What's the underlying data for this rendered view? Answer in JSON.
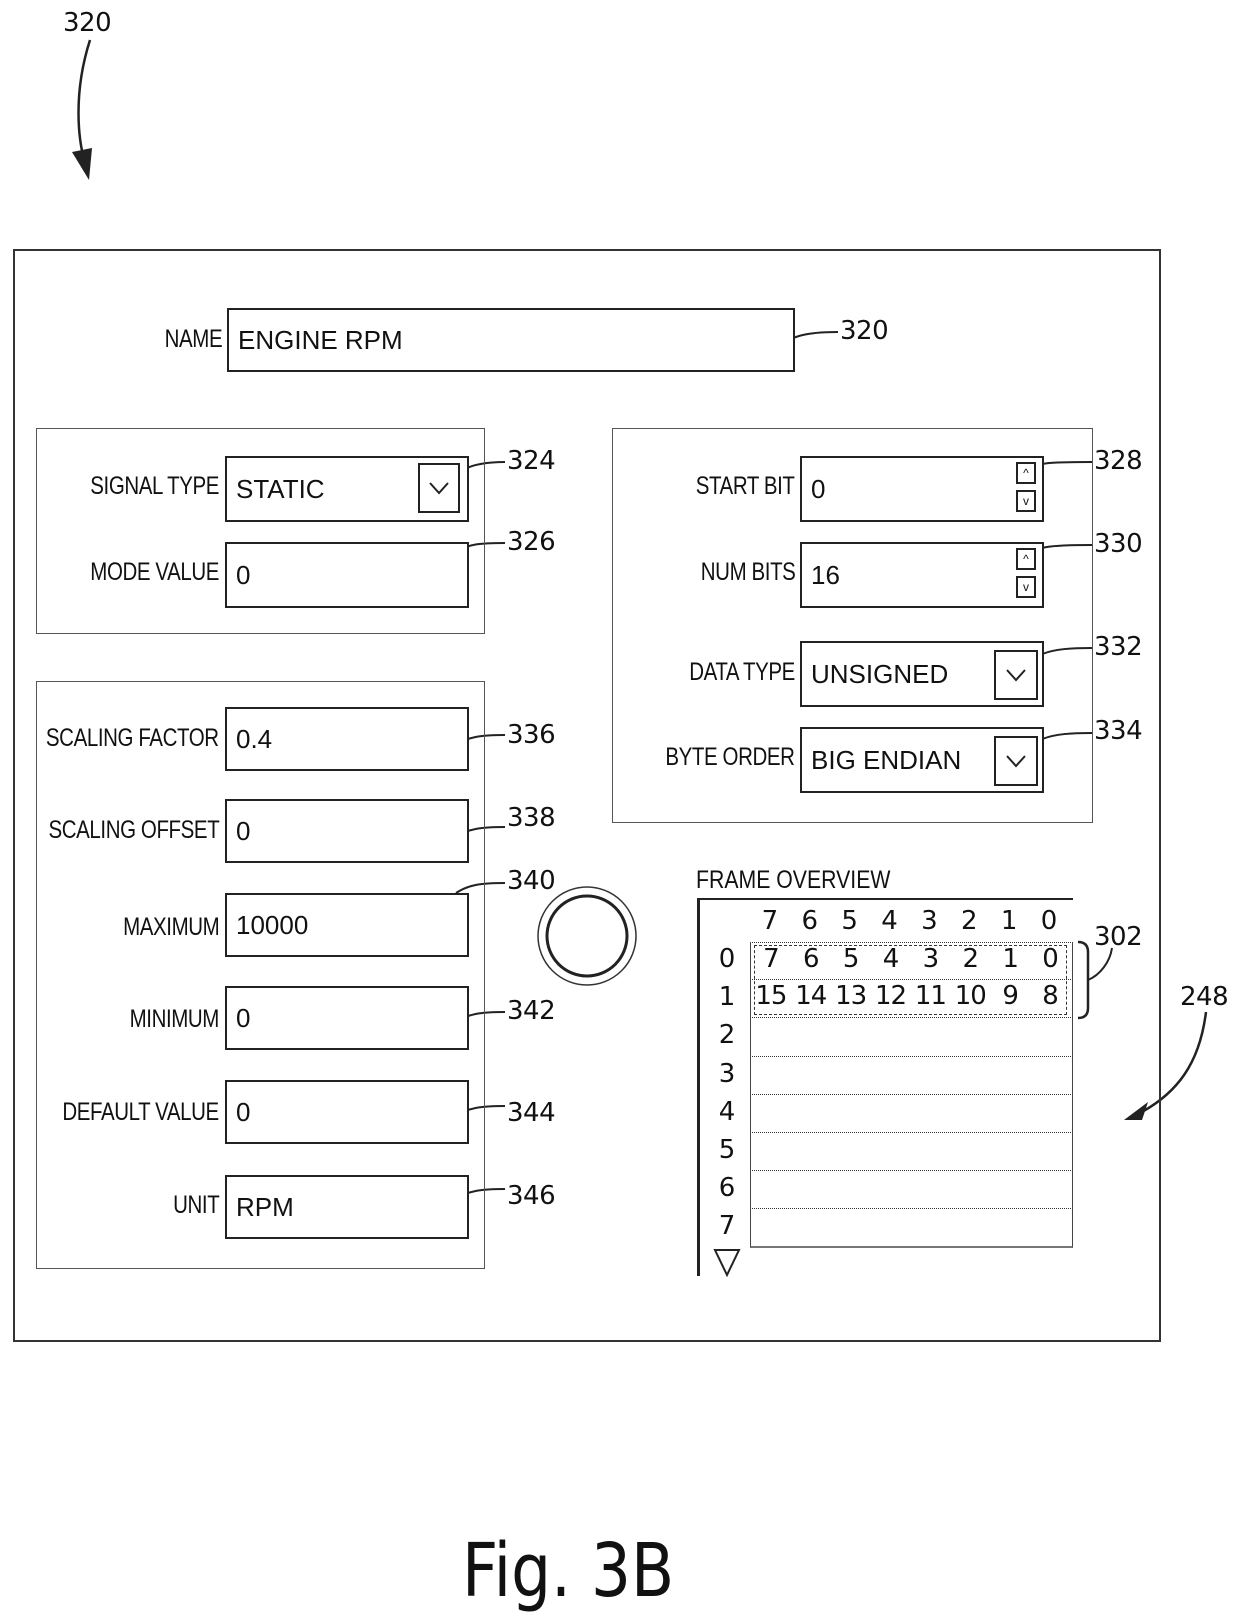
{
  "figure": {
    "ref_main": "320",
    "caption": "Fig. 3B",
    "ref_frame": "248",
    "ref_bytes": "302"
  },
  "name_field": {
    "label": "NAME",
    "value": "ENGINE RPM",
    "ref": "320"
  },
  "signal_group": {
    "signal_type": {
      "label": "SIGNAL TYPE",
      "value": "STATIC",
      "ref": "324",
      "icon": "chevron-down-icon"
    },
    "mode_value": {
      "label": "MODE VALUE",
      "value": "0",
      "ref": "326"
    }
  },
  "bit_group": {
    "start_bit": {
      "label": "START BIT",
      "value": "0",
      "ref": "328",
      "up_icon": "^",
      "down_icon": "v"
    },
    "num_bits": {
      "label": "NUM BITS",
      "value": "16",
      "ref": "330",
      "up_icon": "^",
      "down_icon": "v"
    },
    "data_type": {
      "label": "DATA TYPE",
      "value": "UNSIGNED",
      "ref": "332",
      "icon": "chevron-down-icon"
    },
    "byte_order": {
      "label": "BYTE ORDER",
      "value": "BIG ENDIAN",
      "ref": "334",
      "icon": "chevron-down-icon"
    }
  },
  "scaling_group": {
    "fields": [
      {
        "label": "SCALING FACTOR",
        "value": "0.4",
        "ref": "336"
      },
      {
        "label": "SCALING OFFSET",
        "value": "0",
        "ref": "338"
      },
      {
        "label": "MAXIMUM",
        "value": "10000",
        "ref": "340"
      },
      {
        "label": "MINIMUM",
        "value": "0",
        "ref": "342"
      },
      {
        "label": "DEFAULT VALUE",
        "value": "0",
        "ref": "344"
      },
      {
        "label": "UNIT",
        "value": "RPM",
        "ref": "346"
      }
    ]
  },
  "frame_overview": {
    "title": "FRAME OVERVIEW",
    "bit_headers": [
      "7",
      "6",
      "5",
      "4",
      "3",
      "2",
      "1",
      "0"
    ],
    "row_indices": [
      "0",
      "1",
      "2",
      "3",
      "4",
      "5",
      "6",
      "7"
    ],
    "rows": [
      [
        "7",
        "6",
        "5",
        "4",
        "3",
        "2",
        "1",
        "0"
      ],
      [
        "15",
        "14",
        "13",
        "12",
        "11",
        "10",
        "9",
        "8"
      ],
      [],
      [],
      [],
      [],
      [],
      []
    ],
    "scroll_icon": "triangle-down-icon"
  }
}
